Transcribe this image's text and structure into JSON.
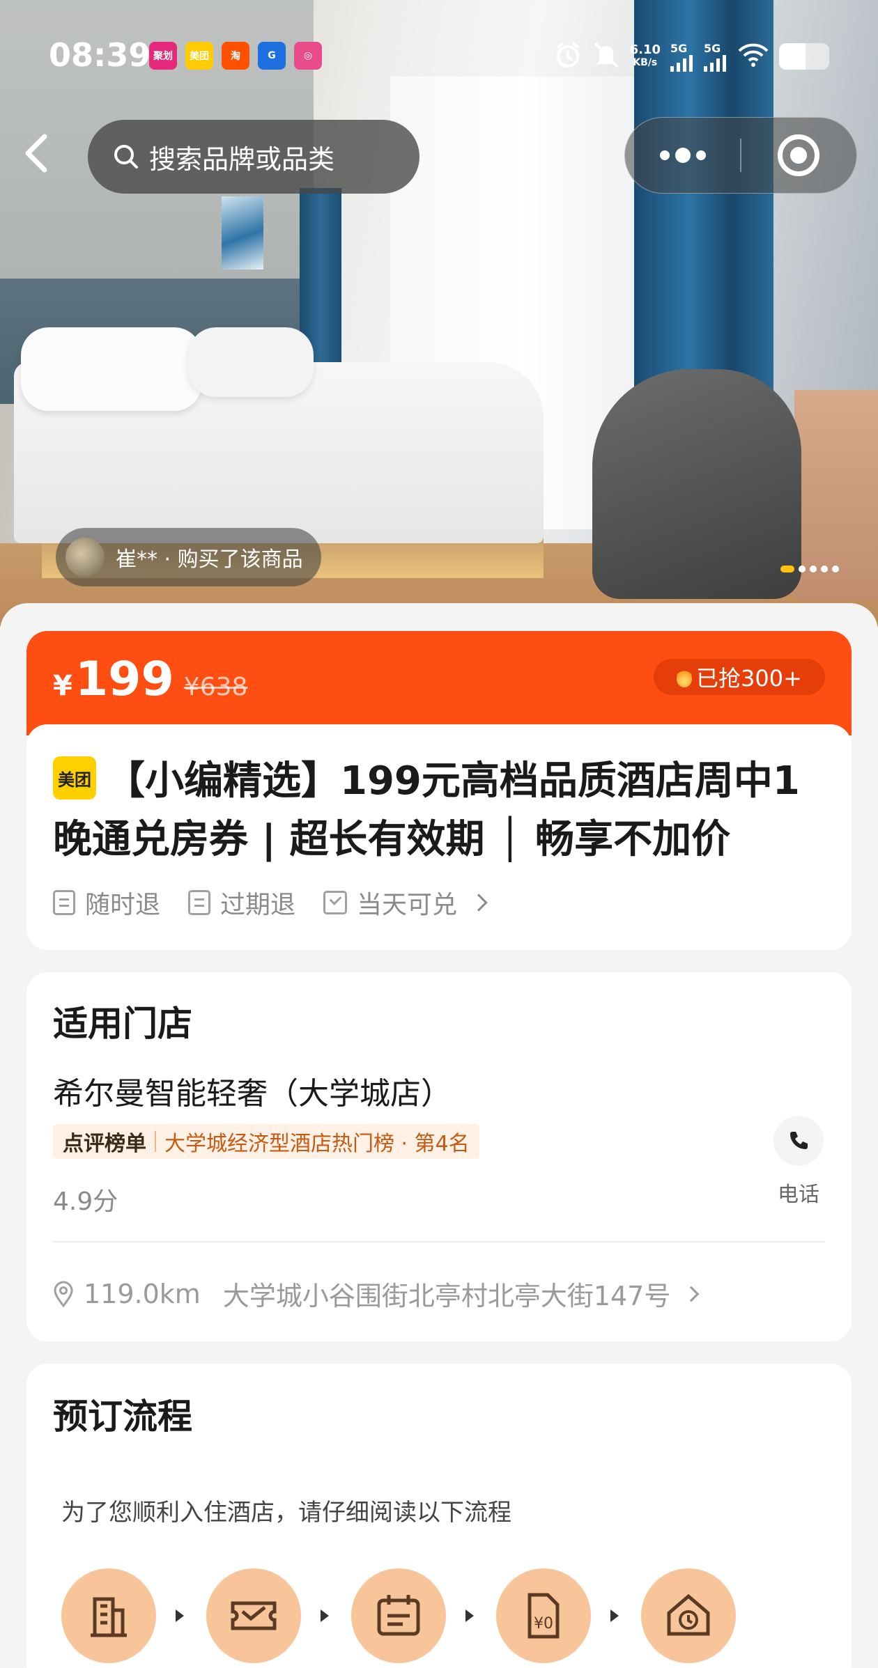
{
  "status_bar": {
    "time": "08:39",
    "apps": [
      {
        "name": "app-icon-1",
        "label": "聚划",
        "color": "#e5287a"
      },
      {
        "name": "app-icon-meituan",
        "label": "美团",
        "color": "#ffcc00"
      },
      {
        "name": "app-icon-taobao",
        "label": "淘",
        "color": "#ff5000"
      },
      {
        "name": "app-icon-4",
        "label": "G",
        "color": "#1e6fe0"
      },
      {
        "name": "app-icon-5",
        "label": "◎",
        "color": "#e94c8a"
      }
    ],
    "net_speed": "6.10",
    "net_unit": "KB/s",
    "sig1": "5G",
    "sig2": "5G"
  },
  "nav": {
    "search_placeholder": "搜索品牌或品类"
  },
  "hero": {
    "buyer_text": "崔** · 购买了该商品",
    "dot_count": 5,
    "active_dot": 0
  },
  "price": {
    "currency": "¥",
    "current": "199",
    "original": "¥638",
    "sold": "已抢300+"
  },
  "product": {
    "badge": "美团",
    "title": "【小编精选】199元高档品质酒店周中1晚通兑房券 | 超长有效期 │ 畅享不加价",
    "tags": [
      "随时退",
      "过期退",
      "当天可兑"
    ]
  },
  "store": {
    "section_title": "适用门店",
    "name": "希尔曼智能轻奢（大学城店）",
    "rank_brand": "点评榜单",
    "rank_text": "大学城经济型酒店热门榜 · 第4名",
    "score": "4.9分",
    "phone_label": "电话",
    "distance": "119.0km",
    "address": "大学城小谷围街北亭村北亭大街147号"
  },
  "booking": {
    "section_title": "预订流程",
    "desc": "为了您顺利入住酒店，请仔细阅读以下流程",
    "steps": [
      "building-icon",
      "ticket-icon",
      "calendar-icon",
      "voucher-icon",
      "clock-home-icon"
    ]
  },
  "colors": {
    "accent": "#ff4e12",
    "meituan_yellow": "#ffd000",
    "step_bg": "#f8c49a"
  }
}
